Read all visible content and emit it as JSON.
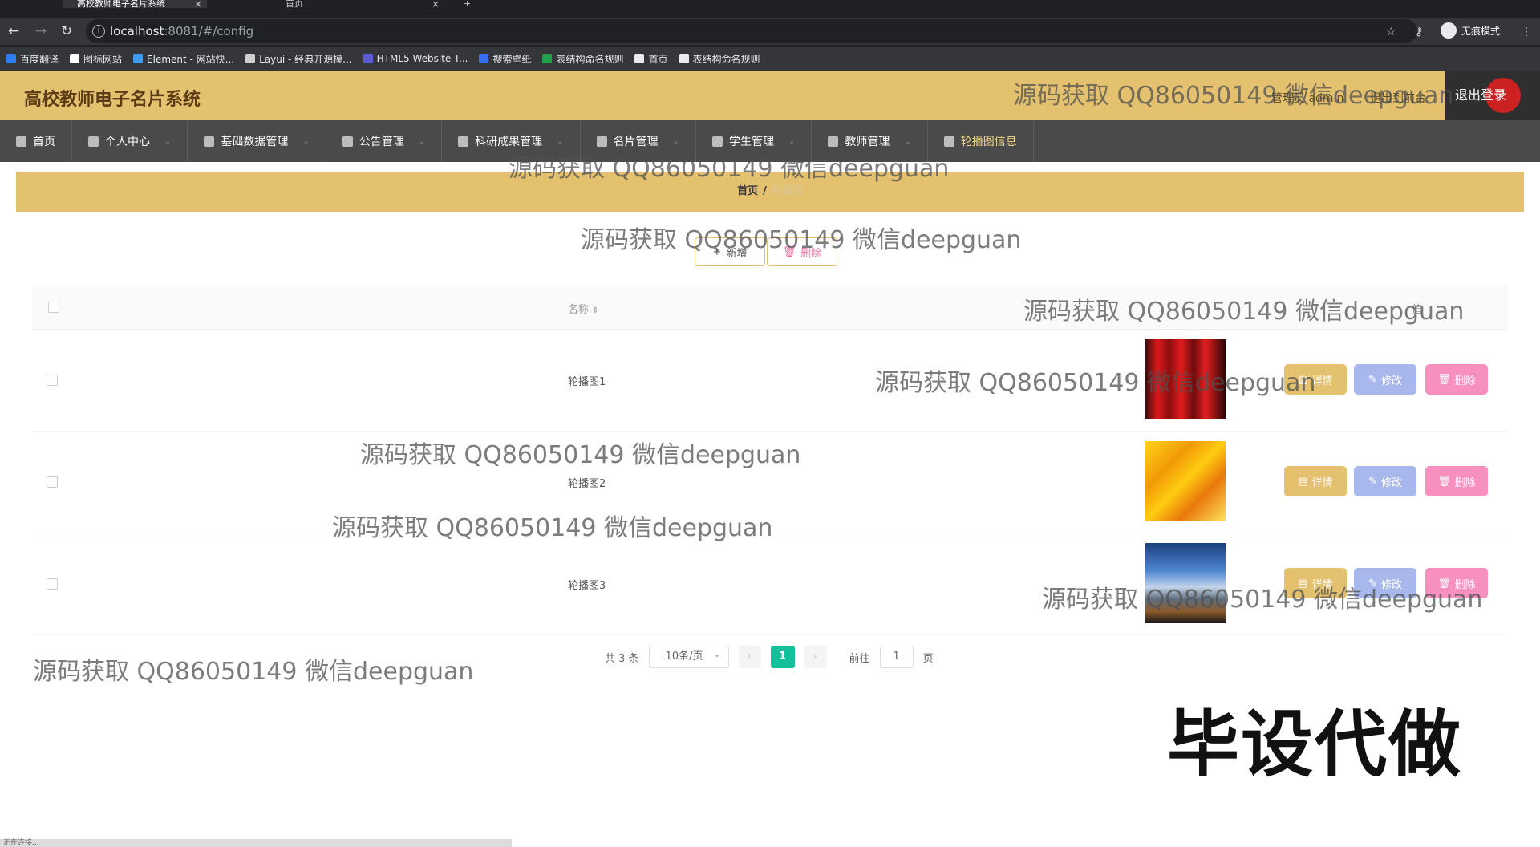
{
  "browser": {
    "tabs": [
      {
        "title": "高校教师电子名片系统",
        "active": true
      },
      {
        "title": "首页",
        "active": false
      }
    ],
    "new_tab_icon": "plus-icon",
    "url_host": "localhost",
    "url_rest": ":8081/#/config",
    "incognito_label": "无痕模式",
    "bookmarks": [
      {
        "label": "百度翻译",
        "color": "#2f7cf6"
      },
      {
        "label": "图标网站",
        "color": "#ffffff"
      },
      {
        "label": "Element - 网站快...",
        "color": "#3f9cf3"
      },
      {
        "label": "Layui - 经典开源模...",
        "color": "#cfcfcf"
      },
      {
        "label": "HTML5 Website T...",
        "color": "#5b5bd6"
      },
      {
        "label": "搜索壁纸",
        "color": "#3a6ef0"
      },
      {
        "label": "表结构命名规则",
        "color": "#1fa24a"
      },
      {
        "label": "首页",
        "color": "#e8eaed"
      },
      {
        "label": "表结构命名规则",
        "color": "#e8eaed"
      }
    ]
  },
  "header": {
    "title": "高校教师电子名片系统",
    "user": "管理员 admin",
    "back_home": "退出到前台",
    "logout": "退出登录"
  },
  "nav": [
    {
      "label": "首页",
      "icon": "home-icon",
      "caret": false
    },
    {
      "label": "个人中心",
      "icon": "user-icon",
      "caret": true
    },
    {
      "label": "基础数据管理",
      "icon": "user-icon",
      "caret": true
    },
    {
      "label": "公告管理",
      "icon": "chart-icon",
      "caret": true
    },
    {
      "label": "科研成果管理",
      "icon": "gear-icon",
      "caret": true
    },
    {
      "label": "名片管理",
      "icon": "clock-icon",
      "caret": true
    },
    {
      "label": "学生管理",
      "icon": "bar-icon",
      "caret": true
    },
    {
      "label": "教师管理",
      "icon": "monitor-icon",
      "caret": true
    },
    {
      "label": "轮播图信息",
      "icon": "flag-icon",
      "caret": false,
      "active": true
    }
  ],
  "breadcrumb": {
    "home": "首页",
    "sep": "/",
    "current": "轮播图"
  },
  "toolbar": {
    "add": "新增",
    "delete": "删除"
  },
  "table": {
    "col_name": "名称",
    "col_value": "值",
    "rows": [
      {
        "name": "轮播图1",
        "image": "red-figures"
      },
      {
        "name": "轮播图2",
        "image": "yellow-abstract"
      },
      {
        "name": "轮播图3",
        "image": "sky-landscape"
      }
    ],
    "actions": {
      "detail": "详情",
      "edit": "修改",
      "remove": "删除"
    }
  },
  "pager": {
    "total": "共 3 条",
    "size": "10条/页",
    "current": "1",
    "goto_label": "前往",
    "goto_value": "1",
    "page_unit": "页"
  },
  "watermark": "源码获取 QQ86050149 微信deepguan",
  "stamp": "毕设代做",
  "status_text": "正在连接..."
}
